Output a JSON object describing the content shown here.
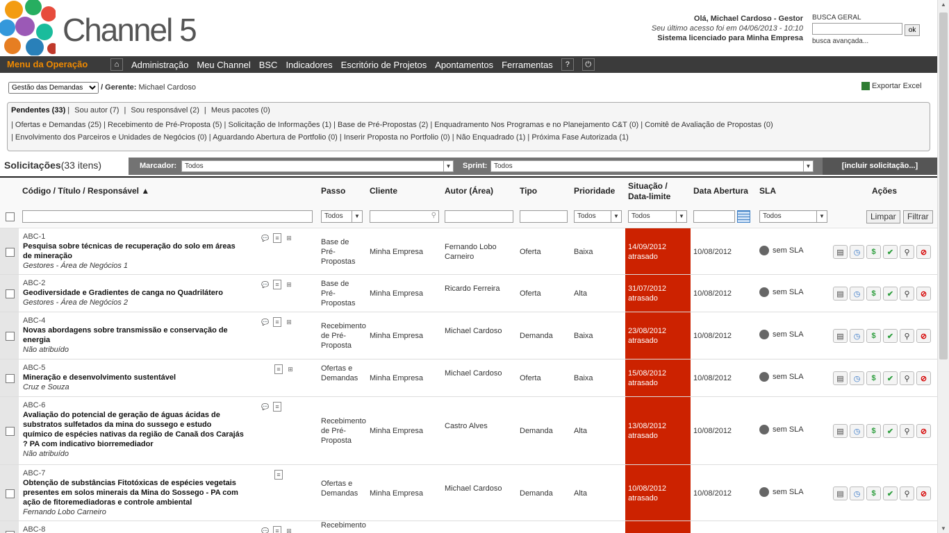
{
  "brand": "Channel 5",
  "user": {
    "greeting": "Olá, Michael Cardoso - Gestor",
    "last_access": "Seu último acesso foi em 04/06/2013 - 10:10",
    "license": "Sistema licenciado para Minha Empresa"
  },
  "search": {
    "label": "BUSCA GERAL",
    "button": "ok",
    "advanced": "busca avançada..."
  },
  "menu": {
    "operation": "Menu da Operação",
    "items": [
      "Administração",
      "Meu Channel",
      "BSC",
      "Indicadores",
      "Escritório de Projetos",
      "Apontamentos",
      "Ferramentas"
    ],
    "help": "?",
    "home_icon": "home-icon",
    "power_icon": "power-icon"
  },
  "subheader": {
    "select_value": "Gestão das Demandas",
    "manager_label": "/ Gerente:",
    "manager_name": "Michael Cardoso",
    "export": "Exportar Excel"
  },
  "panel": {
    "tabs": [
      "Pendentes (33)",
      "Sou autor (7)",
      "Sou responsável (2)",
      "Meus pacotes (0)"
    ],
    "filters_row1": [
      "Ofertas e Demandas (25)",
      "Recebimento de Pré-Proposta (5)",
      "Solicitação de Informações (1)",
      "Base de Pré-Propostas (2)",
      "Enquadramento Nos Programas e no Planejamento C&T (0)",
      "Comitê de Avaliação de Propostas (0)"
    ],
    "filters_row2": [
      "Envolvimento dos Parceiros e Unidades de Negócios (0)",
      "Aguardando Abertura de Portfolio (0)",
      "Inserir Proposta no Portfolio (0)",
      "Não Enquadrado (1)",
      "Próxima Fase Autorizada (1)"
    ]
  },
  "solicitacoes": {
    "title": "Solicitações",
    "count": "(33 itens)"
  },
  "filterbar": {
    "marcador_label": "Marcador:",
    "marcador_value": "Todos",
    "sprint_label": "Sprint:",
    "sprint_value": "Todos",
    "include": "[incluir solicitação...]"
  },
  "columns": {
    "codigo": "Código / Título / Responsável ▲",
    "passo": "Passo",
    "cliente": "Cliente",
    "autor": "Autor (Área)",
    "tipo": "Tipo",
    "prioridade": "Prioridade",
    "situacao1": "Situação /",
    "situacao2": "Data-limite",
    "data": "Data Abertura",
    "sla": "SLA",
    "acoes": "Ações"
  },
  "filters": {
    "todos": "Todos",
    "limpar": "Limpar",
    "filtrar": "Filtrar"
  },
  "rows": [
    {
      "code": "ABC-1",
      "title1": " Pesquisa sobre técnicas de recuperação do solo em áreas",
      "title2": "de mineração",
      "title3": "",
      "title4": "",
      "resp": "Gestores - Área de Negócios 1",
      "passo1": "Base de",
      "passo2": "Pré-",
      "passo3": "Propostas",
      "cliente": "Minha Empresa",
      "autor1": "Fernando Lobo",
      "autor2": "Carneiro",
      "tipo": "Oferta",
      "prio": "Baixa",
      "date": "14/09/2012",
      "status": "atrasado",
      "abertura": "10/08/2012",
      "sla": "sem SLA"
    },
    {
      "code": "ABC-2",
      "title1": " Geodiversidade e Gradientes de canga no Quadrilátero",
      "title2": "",
      "title3": "",
      "title4": "",
      "resp": "Gestores - Área de Negócios 2",
      "passo1": "Base de",
      "passo2": "Pré-",
      "passo3": "Propostas",
      "cliente": "Minha Empresa",
      "autor1": "Ricardo Ferreira",
      "autor2": "",
      "tipo": "Oferta",
      "prio": "Alta",
      "date": "31/07/2012",
      "status": "atrasado",
      "abertura": "10/08/2012",
      "sla": "sem SLA"
    },
    {
      "code": "ABC-4",
      "title1": " Novas abordagens sobre transmissão e conservação de",
      "title2": "energia",
      "title3": "",
      "title4": "",
      "resp": "Não atribuído",
      "passo1": "Recebimento",
      "passo2": "de Pré-",
      "passo3": "Proposta",
      "cliente": "Minha Empresa",
      "autor1": "Michael Cardoso",
      "autor2": "",
      "tipo": "Demanda",
      "prio": "Baixa",
      "date": "23/08/2012",
      "status": "atrasado",
      "abertura": "10/08/2012",
      "sla": "sem SLA"
    },
    {
      "code": "ABC-5",
      "title1": " Mineração e desenvolvimento sustentável",
      "title2": "",
      "title3": "",
      "title4": "",
      "resp": "Cruz e Souza",
      "passo1": "Ofertas e",
      "passo2": "Demandas",
      "passo3": "",
      "cliente": "Minha Empresa",
      "autor1": "Michael Cardoso",
      "autor2": "",
      "tipo": "Oferta",
      "prio": "Baixa",
      "date": "15/08/2012",
      "status": "atrasado",
      "abertura": "10/08/2012",
      "sla": "sem SLA"
    },
    {
      "code": "ABC-6",
      "title1": " Avaliação do potencial de geração de águas ácidas de",
      "title2": "substratos sulfetados da mina do sussego e estudo",
      "title3": "químico de espécies nativas da região de Canaã dos Carajás",
      "title4": "? PA com indicativo biorremediador",
      "resp": "Não atribuído",
      "passo1": "Recebimento",
      "passo2": "de Pré-",
      "passo3": "Proposta",
      "cliente": "Minha Empresa",
      "autor1": "Castro Alves",
      "autor2": "",
      "tipo": "Demanda",
      "prio": "Alta",
      "date": "13/08/2012",
      "status": "atrasado",
      "abertura": "10/08/2012",
      "sla": "sem SLA"
    },
    {
      "code": "ABC-7",
      "title1": " Obtenção de substâncias Fitotóxicas de espécies vegetais",
      "title2": "presentes em solos minerais da Mina do Sossego - PA com",
      "title3": "ação de fitoremediadoras e controle ambiental",
      "title4": "",
      "resp": "Fernando Lobo Carneiro",
      "passo1": "Ofertas e",
      "passo2": "Demandas",
      "passo3": "",
      "cliente": "Minha Empresa",
      "autor1": "Michael Cardoso",
      "autor2": "",
      "tipo": "Demanda",
      "prio": "Alta",
      "date": "10/08/2012",
      "status": "atrasado",
      "abertura": "10/08/2012",
      "sla": "sem SLA"
    },
    {
      "code": "ABC-8",
      "title1": "",
      "title2": "",
      "title3": "",
      "title4": "",
      "resp": "",
      "passo1": "Recebimento",
      "passo2": "",
      "passo3": "",
      "cliente": "",
      "autor1": "",
      "autor2": "",
      "tipo": "",
      "prio": "",
      "date": "",
      "status": "",
      "abertura": "",
      "sla": ""
    }
  ]
}
